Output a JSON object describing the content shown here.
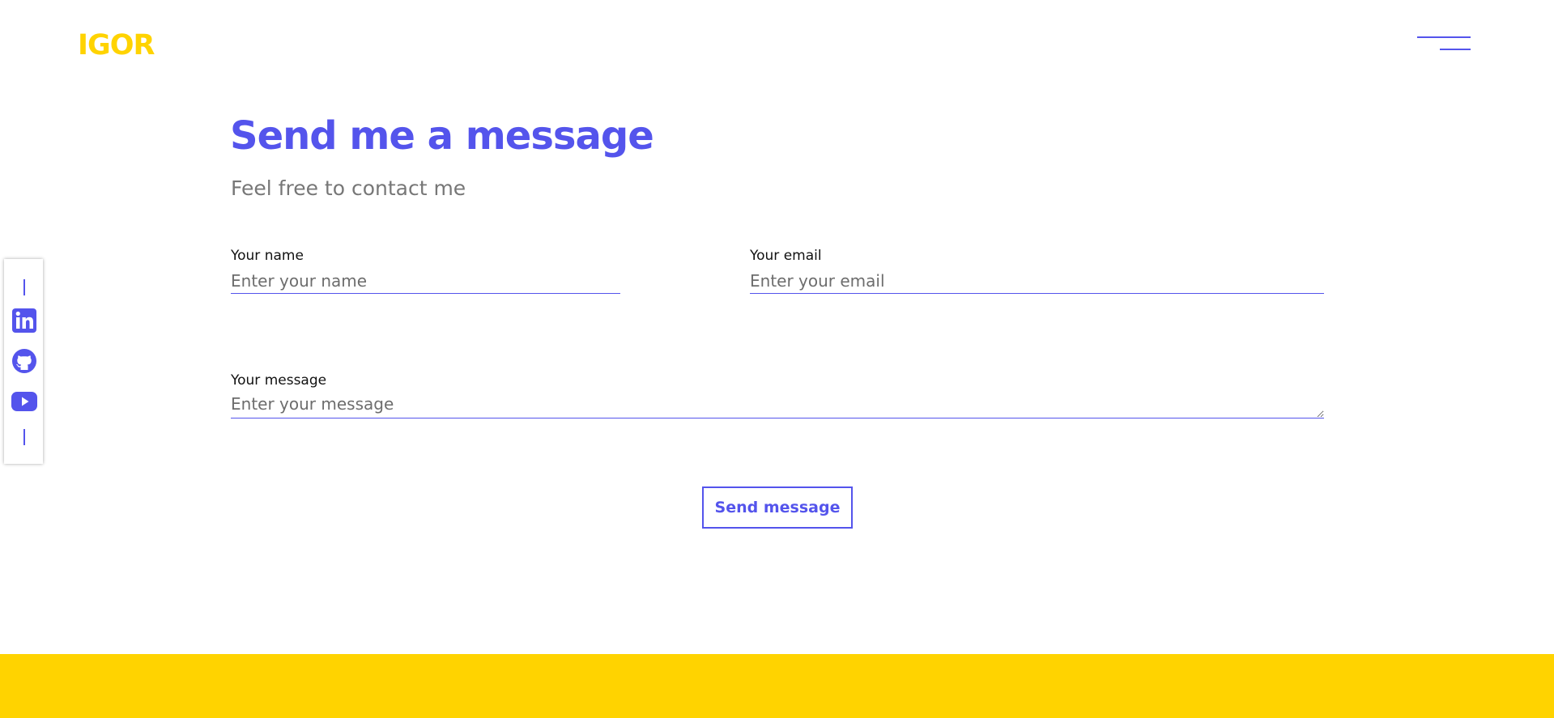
{
  "header": {
    "logo": "IGOR",
    "menu_icon": "hamburger-menu-icon"
  },
  "social": {
    "items": [
      {
        "name": "linkedin",
        "icon": "linkedin-icon"
      },
      {
        "name": "github",
        "icon": "github-icon"
      },
      {
        "name": "youtube",
        "icon": "youtube-icon"
      }
    ]
  },
  "contact": {
    "title": "Send me a message",
    "subtitle": "Feel free to contact me",
    "name_label": "Your name",
    "name_placeholder": "Enter your name",
    "name_value": "",
    "email_label": "Your email",
    "email_placeholder": "Enter your email",
    "email_value": "",
    "message_label": "Your message",
    "message_placeholder": "Enter your message",
    "message_value": "",
    "submit_label": "Send message"
  },
  "colors": {
    "accent": "#5454ec",
    "brand_yellow": "#ffd300",
    "subtitle_gray": "#777777"
  }
}
